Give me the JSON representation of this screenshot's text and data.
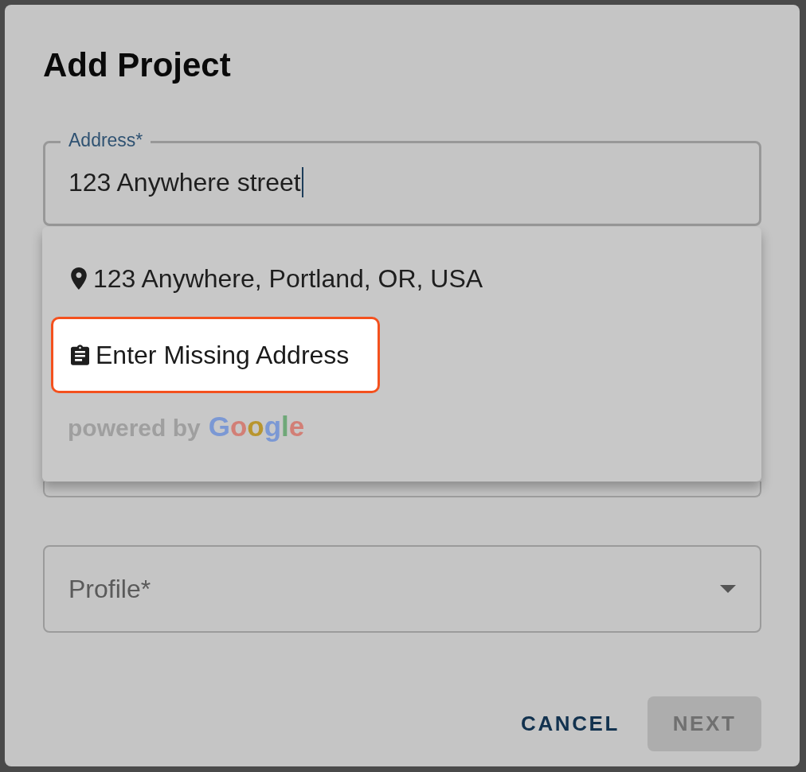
{
  "dialog": {
    "title": "Add Project"
  },
  "address_field": {
    "label": "Address*",
    "value": "123 Anywhere street",
    "focused": true
  },
  "suggestions": [
    {
      "kind": "place",
      "text": "123 Anywhere, Portland, OR, USA",
      "highlighted": false
    },
    {
      "kind": "manual",
      "text": "Enter Missing Address",
      "highlighted": true
    }
  ],
  "attribution": {
    "prefix": "powered by",
    "brand": "Google"
  },
  "profile_select": {
    "placeholder": "Profile*"
  },
  "buttons": [
    {
      "label": "CANCEL",
      "kind": "text",
      "disabled": false
    },
    {
      "label": "NEXT",
      "kind": "contained",
      "disabled": true
    }
  ]
}
